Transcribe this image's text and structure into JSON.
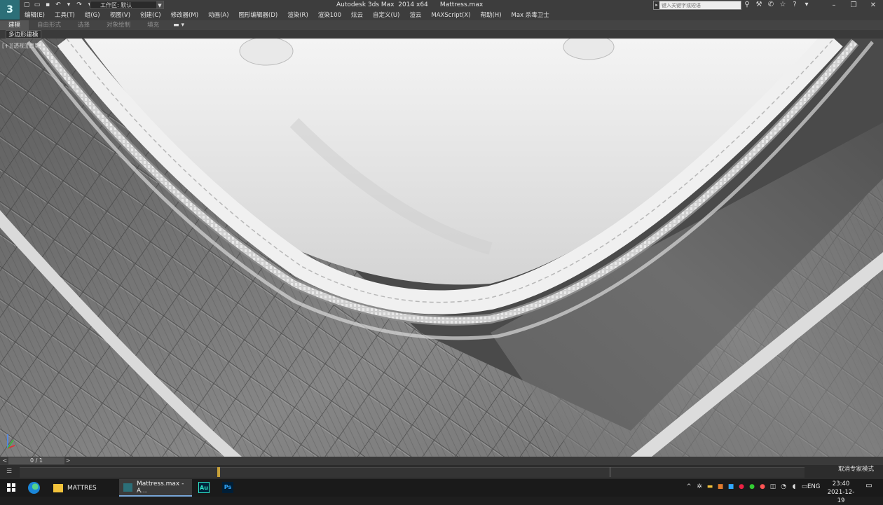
{
  "window": {
    "title": "Autodesk 3ds Max  2014 x64      Mattress.max",
    "workspace_label": "工作区: 默认",
    "search_placeholder": "键入关键字或短语"
  },
  "menu": [
    "编辑(E)",
    "工具(T)",
    "组(G)",
    "视图(V)",
    "创建(C)",
    "修改器(M)",
    "动画(A)",
    "图形编辑器(D)",
    "渲染(R)",
    "渲染100",
    "炫云",
    "自定义(U)",
    "渲云",
    "MAXScript(X)",
    "帮助(H)",
    "Max 杀毒卫士"
  ],
  "ribbon": {
    "tabs": [
      "建模",
      "自由形式",
      "选择",
      "对象绘制",
      "填充"
    ],
    "active_tab": "建模",
    "sub_tab": "多边形建模"
  },
  "viewport": {
    "label": "[+][透视][真实]",
    "background": "#4a4a4a"
  },
  "timeline": {
    "counter": "0 / 1",
    "prev": "<",
    "next": ">",
    "position": 0
  },
  "status": {
    "mode_text": "取消专家模式"
  },
  "taskbar": {
    "explorer_label": "MATTRES",
    "max_label": "Mattress.max - A...",
    "au_label": "Au",
    "ps_label": "Ps",
    "lang": "ENG",
    "time": "23:40",
    "date": "2021-12-19"
  },
  "icons": {
    "logo": "3ds-max-logo-icon",
    "tray": [
      "chevron-up-icon",
      "settings-icon",
      "folder-icon",
      "shield-icon",
      "app-icon",
      "color-icon",
      "wechat-icon",
      "antivirus-icon",
      "camera-icon",
      "wifi-icon",
      "speaker-icon",
      "ime-icon"
    ]
  },
  "colors": {
    "accent": "#78a6d8",
    "timeline_cursor": "#c7a13a",
    "au": "#2ee6c8",
    "ps": "#31a8ff"
  }
}
